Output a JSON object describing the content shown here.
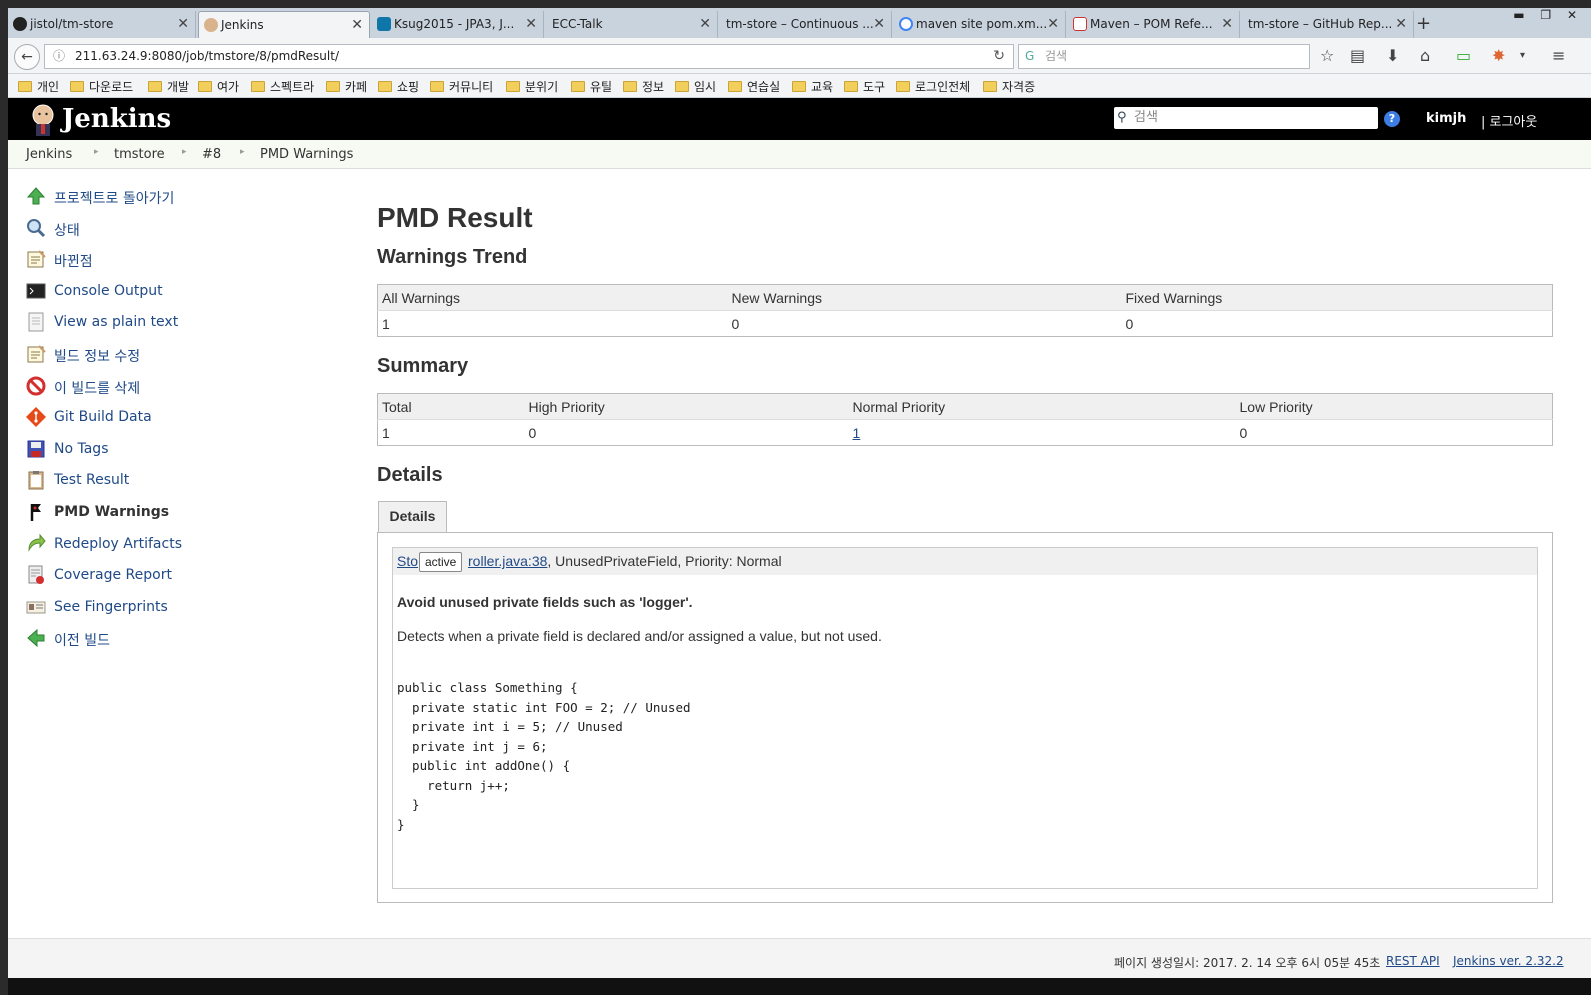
{
  "browser": {
    "tabs": [
      {
        "title": "jistol/tm-store",
        "icon": "github-icon"
      },
      {
        "title": "Jenkins",
        "icon": "jenkins-icon",
        "active": true
      },
      {
        "title": "Ksug2015 - JPA3, J...",
        "icon": "linkedin-icon"
      },
      {
        "title": "ECC-Talk",
        "icon": "blank-icon"
      },
      {
        "title": "tm-store – Continuous ...",
        "icon": "blank-icon"
      },
      {
        "title": "maven site pom.xm...",
        "icon": "google-icon"
      },
      {
        "title": "Maven – POM Refe...",
        "icon": "maven-icon"
      },
      {
        "title": "tm-store – GitHub Rep...",
        "icon": "blank-icon"
      }
    ],
    "url": "211.63.24.9:8080/job/tmstore/8/pmdResult/",
    "search_placeholder": "검색",
    "bookmarks": [
      "개인",
      "다운로드",
      "개발",
      "여가",
      "스펙트라",
      "카페",
      "쇼핑",
      "커뮤니티",
      "분위기",
      "유틸",
      "정보",
      "임시",
      "연습실",
      "교육",
      "도구",
      "로그인전체",
      "자격증"
    ]
  },
  "header": {
    "logo_text": "Jenkins",
    "search_placeholder": "검색",
    "help": "?",
    "user": "kimjh",
    "logout": "| 로그아웃"
  },
  "breadcrumbs": [
    "Jenkins",
    "tmstore",
    "#8",
    "PMD Warnings"
  ],
  "side_tasks": [
    {
      "label": "프로젝트로 돌아가기",
      "icon": "up-arrow-icon"
    },
    {
      "label": "상태",
      "icon": "search-icon"
    },
    {
      "label": "바뀐점",
      "icon": "notepad-icon"
    },
    {
      "label": "Console Output",
      "icon": "terminal-icon"
    },
    {
      "label": "View as plain text",
      "icon": "document-icon"
    },
    {
      "label": "빌드 정보 수정",
      "icon": "notepad-icon"
    },
    {
      "label": "이 빌드를 삭제",
      "icon": "no-entry-icon"
    },
    {
      "label": "Git Build Data",
      "icon": "git-icon"
    },
    {
      "label": "No Tags",
      "icon": "save-icon"
    },
    {
      "label": "Test Result",
      "icon": "clipboard-icon"
    },
    {
      "label": "PMD Warnings",
      "icon": "pmd-icon",
      "current": true
    },
    {
      "label": "Redeploy Artifacts",
      "icon": "redeploy-icon"
    },
    {
      "label": "Coverage Report",
      "icon": "coverage-icon"
    },
    {
      "label": "See Fingerprints",
      "icon": "fingerprint-icon"
    },
    {
      "label": "이전 빌드",
      "icon": "left-arrow-icon"
    }
  ],
  "main": {
    "title": "PMD Result",
    "trend_heading": "Warnings Trend",
    "trend_headers": [
      "All Warnings",
      "New Warnings",
      "Fixed Warnings"
    ],
    "trend_values": [
      "1",
      "0",
      "0"
    ],
    "summary_heading": "Summary",
    "summary_headers": [
      "Total",
      "High Priority",
      "Normal Priority",
      "Low Priority"
    ],
    "summary_values": [
      "1",
      "0",
      "1",
      "0"
    ],
    "details_heading": "Details",
    "details_tab": "Details",
    "warning": {
      "link_prefix": "Sto",
      "tooltip": "active",
      "link_suffix": "roller.java:38",
      "meta": ", UnusedPrivateField, Priority: Normal",
      "title": "Avoid unused private fields such as 'logger'.",
      "description": "Detects when a private field is declared and/or assigned a value, but not used.",
      "code": "public class Something {\n  private static int FOO = 2; // Unused\n  private int i = 5; // Unused\n  private int j = 6;\n  public int addOne() {\n    return j++;\n  }\n}"
    }
  },
  "footer": {
    "generated": "페이지 생성일시: 2017. 2. 14 오후 6시 05분 45초",
    "rest_api": "REST API",
    "version": "Jenkins ver. 2.32.2"
  },
  "colors": {
    "link": "#204a87",
    "header_bg": "#000000",
    "breadcrumb_bg": "#f6faf2"
  }
}
